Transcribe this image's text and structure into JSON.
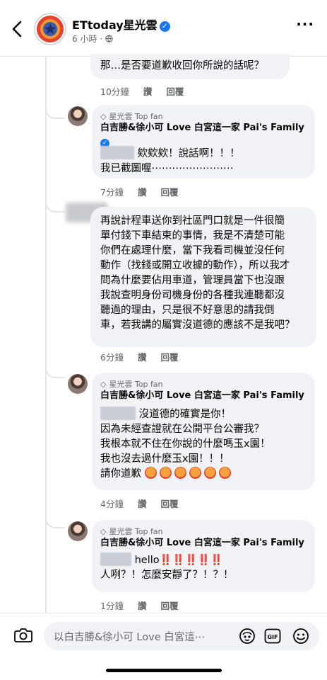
{
  "header": {
    "title": "ETtoday星光雲",
    "time": "6 小時",
    "audience_icon": "globe-icon"
  },
  "comments": [
    {
      "text_lines": [
        "那…是否要道歉收回你所說的話呢？"
      ],
      "time": "10分鐘",
      "like": "讚",
      "reply": "回覆"
    },
    {
      "badge": "星光雲 Top fan",
      "author": "白吉勝&徐小可 Love 白宮這一家 Pai's Family",
      "text_lines": [
        "欸欸欸！說話啊！！！",
        "我已截圖喔⋯⋯⋯⋯⋯⋯⋯⋯"
      ],
      "time": "7分鐘",
      "like": "讚",
      "reply": "回覆"
    },
    {
      "text_lines": [
        "再說計程車送你到社區門口就是一件很簡",
        "單付錢下車結束的事情，我是不清楚可能",
        "你們在處理什麼，當下我看司機並沒任何",
        "動作（找錢或開立收據的動作），所以我才",
        "問為什麼要佔用車道，管理員當下也沒跟",
        "我說查明身份司機身份的各種我連聽都沒",
        "聽過的理由，只是很不好意思的請我倒",
        "車，若我講的屬實沒道德的應該不是我吧？"
      ],
      "time": "6分鐘",
      "like": "讚",
      "reply": "回覆"
    },
    {
      "badge": "星光雲 Top fan",
      "author": "白吉勝&徐小可 Love 白宮這一家 Pai's Family",
      "text_lines": [
        "沒道德的確實是你！",
        "因為未經查證就在公開平台公審我？",
        "我根本就不住在你說的什麼嗎玉x園！",
        "我也沒去過什麼玉x園！！！",
        "請你道歉"
      ],
      "emoji_count": 6,
      "time": "4分鐘",
      "like": "讚",
      "reply": "回覆"
    },
    {
      "badge": "星光雲 Top fan",
      "author": "白吉勝&徐小可 Love 白宮這一家 Pai's Family",
      "text_lines": [
        "hello",
        "人咧？！怎麼安靜了？！？！"
      ],
      "exclaim": "‼️‼️‼️‼️‼️",
      "time": "1分鐘",
      "like": "讚",
      "reply": "回覆"
    }
  ],
  "composer": {
    "placeholder": "以白吉勝&徐小可 Love 白宮這⋯",
    "icons": [
      "camera-icon",
      "avatar-sticker-icon",
      "gif-icon",
      "emoji-icon"
    ]
  },
  "colors": {
    "accent": "#1877f2",
    "bubble": "#f0f2f5",
    "meta_text": "#65676b",
    "exclaim_red": "#e0251b"
  }
}
